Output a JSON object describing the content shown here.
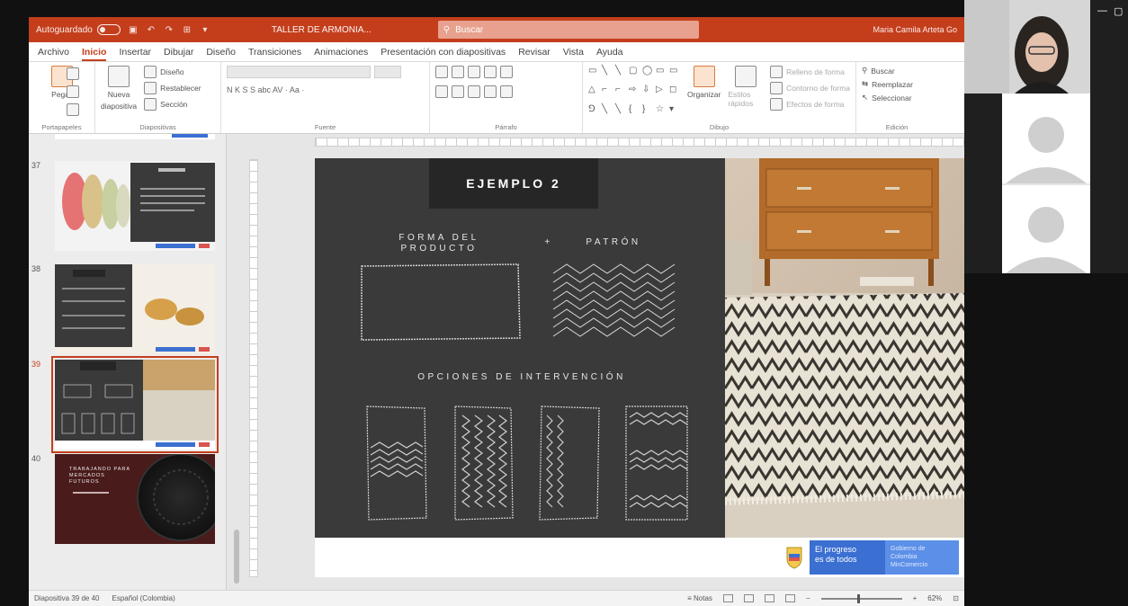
{
  "window": {
    "autosave_label": "Autoguardado",
    "doc_title": "TALLER DE ARMONIA...",
    "search_placeholder": "Buscar",
    "user_name": "Maria Camila Arteta Go"
  },
  "menu": [
    "Archivo",
    "Inicio",
    "Insertar",
    "Dibujar",
    "Diseño",
    "Transiciones",
    "Animaciones",
    "Presentación con diapositivas",
    "Revisar",
    "Vista",
    "Ayuda"
  ],
  "menu_active": "Inicio",
  "ribbon": {
    "portapapeles": {
      "paste": "Pegar",
      "label": "Portapapeles"
    },
    "diapositivas": {
      "new": "Nueva",
      "new2": "diapositiva",
      "layout": "Diseño",
      "reset": "Restablecer",
      "section": "Sección",
      "label": "Diapositivas"
    },
    "fuente": {
      "label": "Fuente",
      "format": "N  K  S  S  abc  AV ·  Aa ·"
    },
    "parrafo": {
      "label": "Párrafo"
    },
    "dibujo": {
      "arrange": "Organizar",
      "quick_styles": "Estilos rápidos",
      "fill": "Relleno de forma",
      "outline": "Contorno de forma",
      "effects": "Efectos de forma",
      "label": "Dibujo"
    },
    "edicion": {
      "find": "Buscar",
      "replace": "Reemplazar",
      "select": "Seleccionar",
      "label": "Edición"
    }
  },
  "thumbnails": {
    "numbers": [
      "37",
      "38",
      "39",
      "40"
    ],
    "selected_index": 2,
    "slide40_text": "TRABAJANDO PARA MERCADOS FUTUROS"
  },
  "slide": {
    "title": "EJEMPLO 2",
    "caption_form_1": "FORMA DEL",
    "caption_form_2": "PRODUCTO",
    "plus": "+",
    "caption_pattern": "PATRÓN",
    "caption_options": "OPCIONES DE INTERVENCIÓN",
    "gov_text_1": "El progreso",
    "gov_text_2": "es de todos",
    "gov_text_3": "Gobierno de Colombia MinComercio"
  },
  "statusbar": {
    "slide_count": "Diapositiva 39 de 40",
    "language": "Español (Colombia)",
    "notes": "Notas",
    "zoom": "62%"
  },
  "colors": {
    "ppt_accent": "#c43e1c",
    "slide_dark": "#3a3a3a",
    "gov_blue": "#3b6fd1"
  }
}
